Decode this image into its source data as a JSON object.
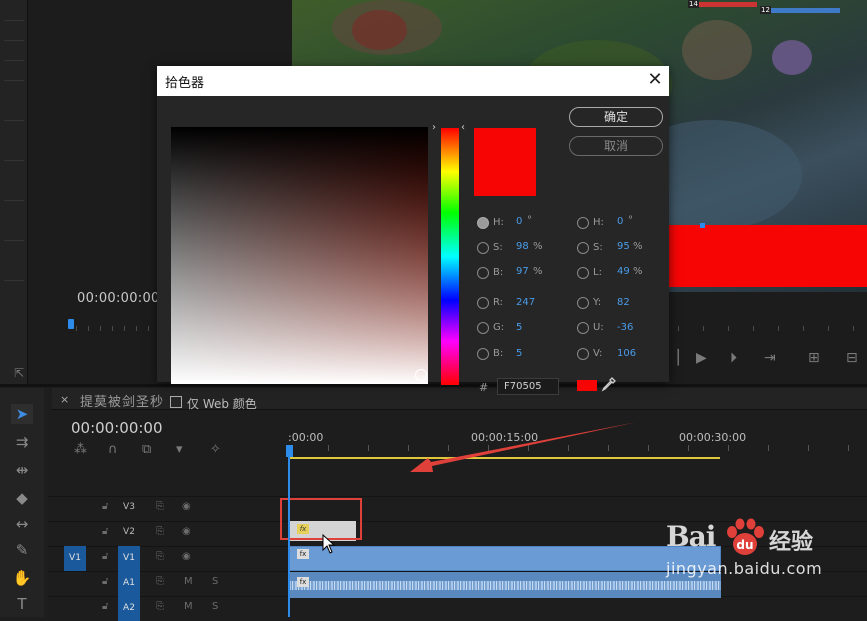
{
  "source_monitor": {
    "timecode": "00:00:00:00"
  },
  "program_monitor": {
    "hud_left_level": "14",
    "hud_right_level": "12"
  },
  "color_picker": {
    "title": "拾色器",
    "close_glyph": "✕",
    "ok_label": "确定",
    "cancel_label": "取消",
    "selected_color": "#f70505",
    "hsb": {
      "h_label": "H:",
      "h_value": "0",
      "h_unit": "°",
      "s_label": "S:",
      "s_value": "98",
      "s_unit": "%",
      "b_label": "B:",
      "b_value": "97",
      "b_unit": "%"
    },
    "hsl": {
      "h_label": "H:",
      "h_value": "0",
      "h_unit": "°",
      "s_label": "S:",
      "s_value": "95",
      "s_unit": "%",
      "l_label": "L:",
      "l_value": "49",
      "l_unit": "%"
    },
    "rgb": {
      "r_label": "R:",
      "r_value": "247",
      "g_label": "G:",
      "g_value": "5",
      "b_label": "B:",
      "b_value": "5"
    },
    "yuv": {
      "y_label": "Y:",
      "y_value": "82",
      "u_label": "U:",
      "u_value": "-36",
      "v_label": "V:",
      "v_value": "106"
    },
    "hash": "#",
    "hex_value": "F70505",
    "web_only_label": "仅 Web 颜色",
    "web_only_checked": false
  },
  "timeline": {
    "tab_close": "×",
    "tab_title": "提莫被剑圣秒",
    "timecode": "00:00:00:00",
    "ruler_labels": [
      ":00:00",
      "00:00:15:00",
      "00:00:30:00"
    ],
    "tracks": [
      {
        "name": "V3",
        "source": ""
      },
      {
        "name": "V2",
        "source": ""
      },
      {
        "name": "V1",
        "source": "V1"
      },
      {
        "name": "A1",
        "source": "",
        "m": "M",
        "s": "S"
      },
      {
        "name": "A2",
        "source": "",
        "m": "M",
        "s": "S"
      }
    ],
    "fx_badge": "fx"
  },
  "watermark": {
    "brand": "Bai",
    "brand_cn": "经验",
    "url": "jingyan.baidu.com"
  },
  "icons": [
    "selection-tool-icon",
    "track-select-icon",
    "ripple-edit-icon",
    "razor-icon",
    "slip-icon",
    "pen-icon",
    "hand-icon",
    "type-icon",
    "eyedropper-icon",
    "lock-icon",
    "eye-icon",
    "play-icon"
  ],
  "colors": {
    "accent_blue": "#2d8ceb",
    "annotation_red": "#e0403a",
    "clip_blue": "#6b9bd4",
    "work_area_yellow": "#e0c63a"
  }
}
